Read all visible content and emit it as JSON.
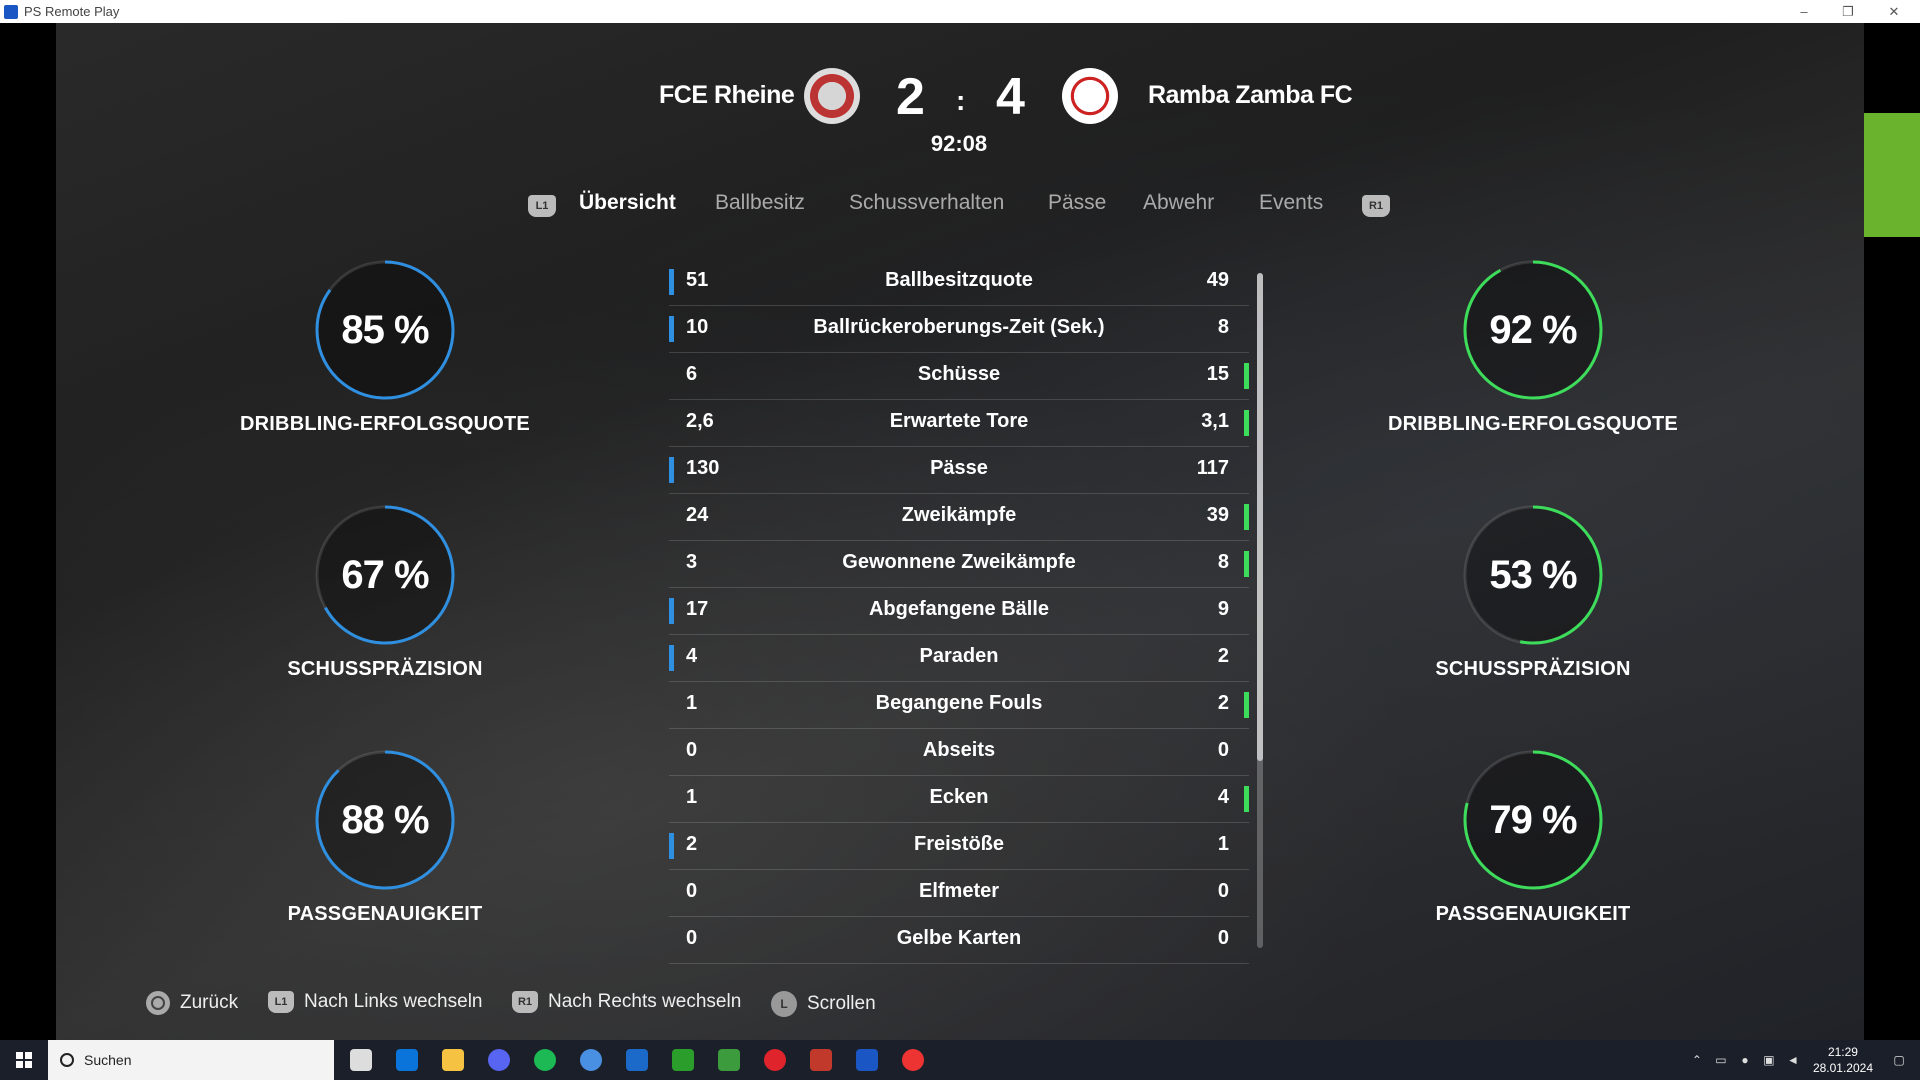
{
  "window": {
    "title": "PS Remote Play",
    "minimize": "–",
    "restore": "❐",
    "close": "✕"
  },
  "match": {
    "home_team": "FCE Rheine",
    "away_team": "Ramba Zamba FC",
    "home_score": "2",
    "separator": ":",
    "away_score": "4",
    "clock": "92:08"
  },
  "tabs": {
    "left_shoulder": "L1",
    "right_shoulder": "R1",
    "items": [
      "Übersicht",
      "Ballbesitz",
      "Schussverhalten",
      "Pässe",
      "Abwehr",
      "Events"
    ],
    "active": "Übersicht"
  },
  "left_rings": [
    {
      "value": "85 %",
      "label": "DRIBBLING-ERFOLGSQUOTE",
      "fraction": 0.85
    },
    {
      "value": "67 %",
      "label": "SCHUSSPRÄZISION",
      "fraction": 0.67
    },
    {
      "value": "88 %",
      "label": "PASSGENAUIGKEIT",
      "fraction": 0.88
    }
  ],
  "right_rings": [
    {
      "value": "92 %",
      "label": "DRIBBLING-ERFOLGSQUOTE",
      "fraction": 0.92
    },
    {
      "value": "53 %",
      "label": "SCHUSSPRÄZISION",
      "fraction": 0.53
    },
    {
      "value": "79 %",
      "label": "PASSGENAUIGKEIT",
      "fraction": 0.79
    }
  ],
  "stats": [
    {
      "name": "Ballbesitzquote",
      "home": "51",
      "away": "49",
      "leader": "home"
    },
    {
      "name": "Ballrückeroberungs-Zeit (Sek.)",
      "home": "10",
      "away": "8",
      "leader": "home"
    },
    {
      "name": "Schüsse",
      "home": "6",
      "away": "15",
      "leader": "away"
    },
    {
      "name": "Erwartete Tore",
      "home": "2,6",
      "away": "3,1",
      "leader": "away"
    },
    {
      "name": "Pässe",
      "home": "130",
      "away": "117",
      "leader": "home"
    },
    {
      "name": "Zweikämpfe",
      "home": "24",
      "away": "39",
      "leader": "away"
    },
    {
      "name": "Gewonnene Zweikämpfe",
      "home": "3",
      "away": "8",
      "leader": "away"
    },
    {
      "name": "Abgefangene Bälle",
      "home": "17",
      "away": "9",
      "leader": "home"
    },
    {
      "name": "Paraden",
      "home": "4",
      "away": "2",
      "leader": "home"
    },
    {
      "name": "Begangene Fouls",
      "home": "1",
      "away": "2",
      "leader": "away"
    },
    {
      "name": "Abseits",
      "home": "0",
      "away": "0",
      "leader": "none"
    },
    {
      "name": "Ecken",
      "home": "1",
      "away": "4",
      "leader": "away"
    },
    {
      "name": "Freistöße",
      "home": "2",
      "away": "1",
      "leader": "home"
    },
    {
      "name": "Elfmeter",
      "home": "0",
      "away": "0",
      "leader": "none"
    },
    {
      "name": "Gelbe Karten",
      "home": "0",
      "away": "0",
      "leader": "none"
    }
  ],
  "hints": {
    "back": "Zurück",
    "left_btn": "L1",
    "left": "Nach Links wechseln",
    "right_btn": "R1",
    "right": "Nach Rechts wechseln",
    "stick": "L",
    "scroll": "Scrollen"
  },
  "colors": {
    "home": "#2f8fe0",
    "away": "#3ddc5a",
    "accent_strip": "#6ab42d"
  },
  "taskbar": {
    "search_placeholder": "Suchen",
    "time": "21:29",
    "date": "28.01.2024",
    "icons": [
      "task-view-icon",
      "store-icon",
      "file-explorer-icon",
      "discord-icon",
      "spotify-icon",
      "app-icon",
      "steam-icon",
      "xbox-icon",
      "minecraft-icon",
      "opera-icon",
      "voicemeeter-icon",
      "ps-remote-play-icon",
      "media-player-icon"
    ]
  }
}
